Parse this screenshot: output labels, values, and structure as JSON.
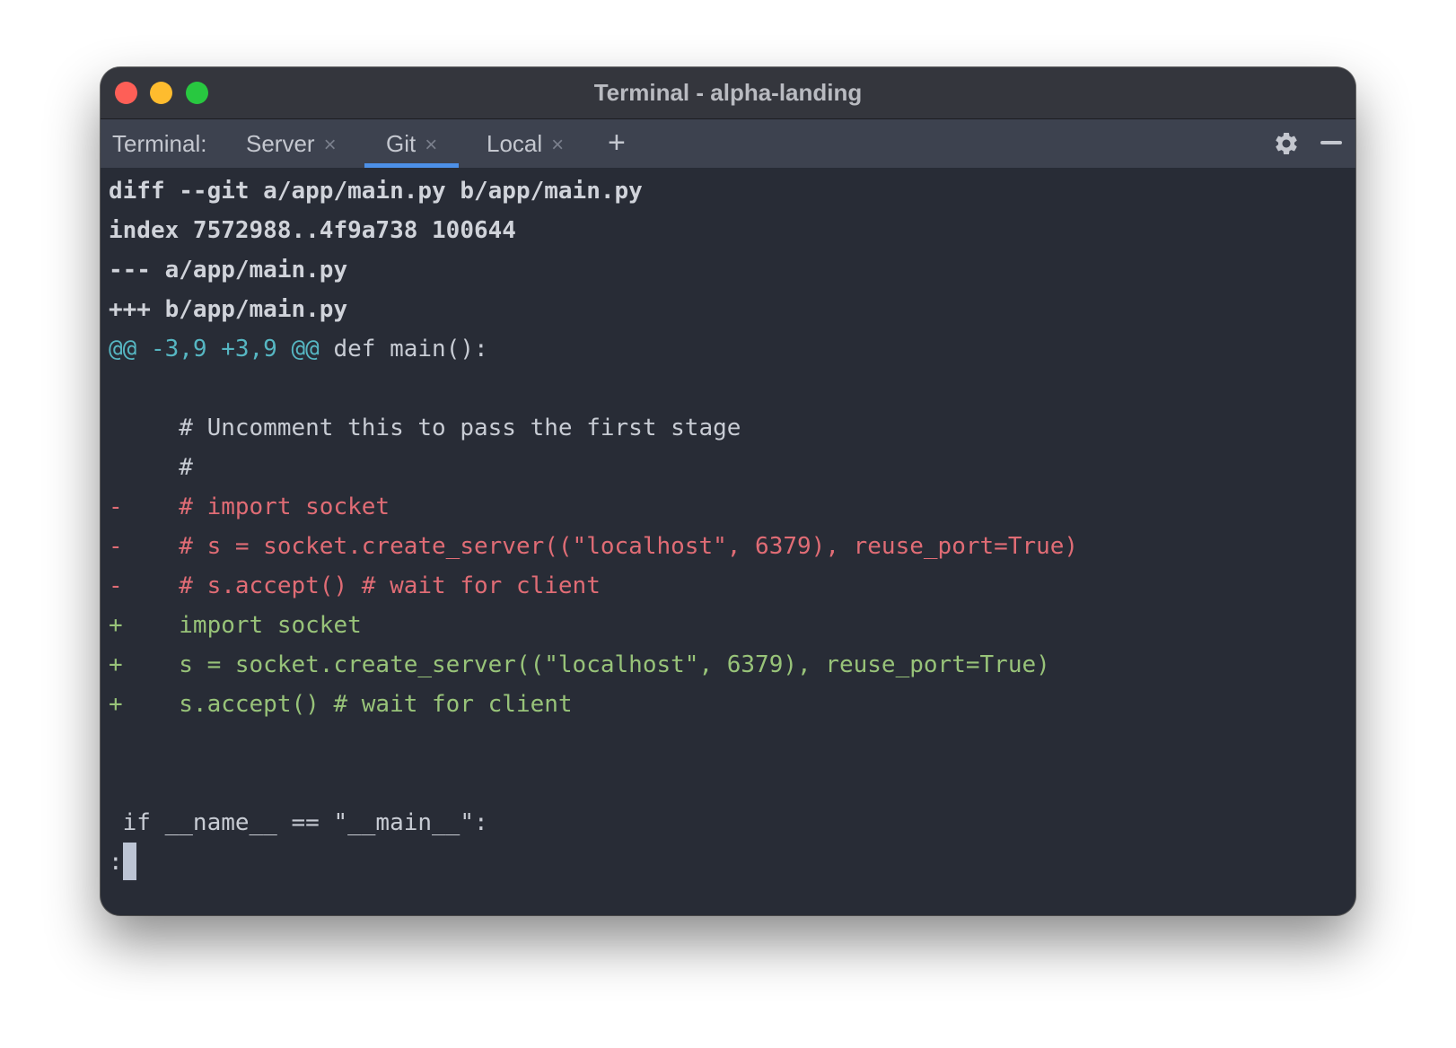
{
  "window": {
    "title": "Terminal - alpha-landing"
  },
  "tabbar": {
    "label": "Terminal:",
    "tabs": [
      {
        "label": "Server",
        "close": "×"
      },
      {
        "label": "Git",
        "close": "×",
        "active": true
      },
      {
        "label": "Local",
        "close": "×"
      }
    ],
    "add_label": "+",
    "icons": [
      "gear-icon",
      "minimize-icon"
    ]
  },
  "colors": {
    "accent": "#4d90e8",
    "removed": "#e06c75",
    "added": "#98c379",
    "hunk": "#56b6c2"
  },
  "terminal": {
    "lines": [
      "diff --git a/app/main.py b/app/main.py",
      "index 7572988..4f9a738 100644",
      "--- a/app/main.py",
      "+++ b/app/main.py",
      "",
      "",
      "     # Uncomment this to pass the first stage",
      "     #",
      "-    # import socket",
      "-    # s = socket.create_server((\"localhost\", 6379), reuse_port=True)",
      "-    # s.accept() # wait for client",
      "+    import socket",
      "+    s = socket.create_server((\"localhost\", 6379), reuse_port=True)",
      "+    s.accept() # wait for client",
      "",
      "",
      " if __name__ == \"__main__\":"
    ],
    "hunk_header": "@@ -3,9 +3,9 @@",
    "hunk_context": " def main():",
    "prompt": ":"
  }
}
